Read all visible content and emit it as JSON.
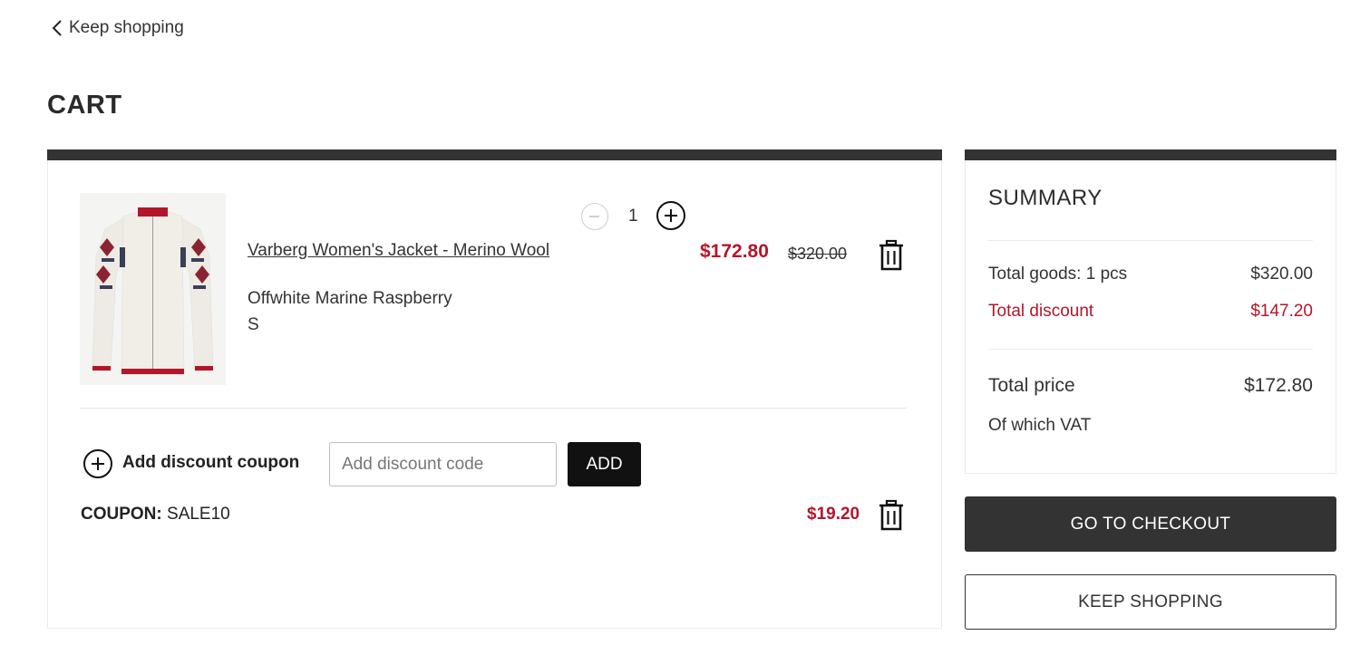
{
  "nav": {
    "back_label": "Keep shopping",
    "back_icon": "chevron-left-icon"
  },
  "page": {
    "title": "CART"
  },
  "cart": {
    "items": [
      {
        "name": "Varberg Women's Jacket - Merino Wool",
        "color": "Offwhite Marine Raspberry",
        "size": "S",
        "quantity": "1",
        "sale_price": "$172.80",
        "original_price": "$320.00"
      }
    ],
    "coupon": {
      "toggle_label": "Add discount coupon",
      "input_placeholder": "Add discount code",
      "input_value": "",
      "add_label": "ADD",
      "applied_prefix": "COUPON:",
      "applied_code": "SALE10",
      "applied_amount": "$19.20"
    }
  },
  "summary": {
    "title": "SUMMARY",
    "total_goods_label": "Total goods: 1 pcs",
    "total_goods_value": "$320.00",
    "total_discount_label": "Total discount",
    "total_discount_value": "$147.20",
    "total_price_label": "Total price",
    "total_price_value": "$172.80",
    "vat_label": "Of which VAT",
    "checkout_label": "GO TO CHECKOUT",
    "keep_shopping_label": "KEEP SHOPPING"
  },
  "colors": {
    "accent_red": "#b3162b",
    "dark": "#333333",
    "button_black": "#111111"
  }
}
